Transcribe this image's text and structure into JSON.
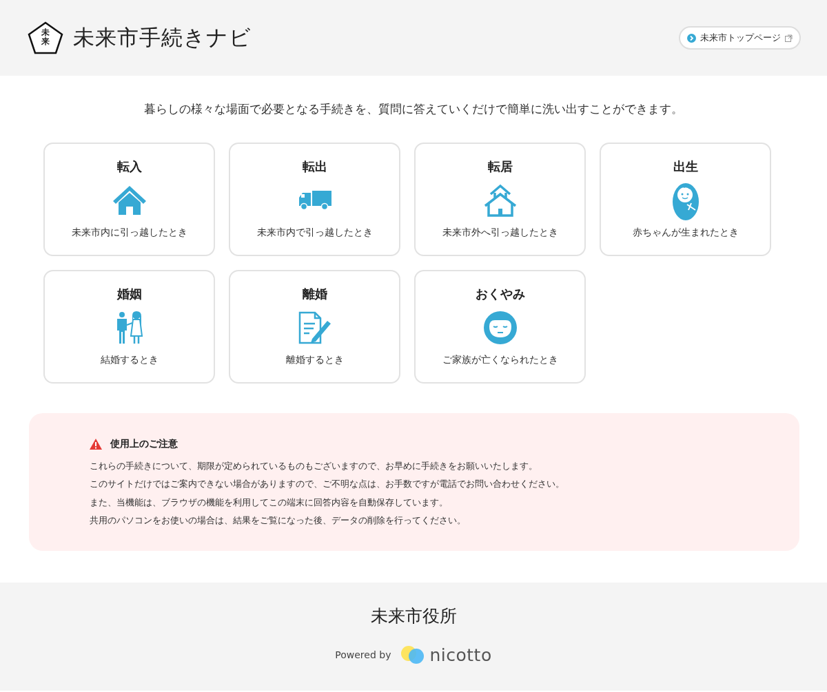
{
  "header": {
    "logo_mark": "未来",
    "title": "未来市手続きナビ",
    "top_link": "未来市トップページ"
  },
  "intro": "暮らしの様々な場面で必要となる手続きを、質問に答えていくだけで簡単に洗い出すことができます。",
  "cards": [
    {
      "title": "転入",
      "kind": "house",
      "caption": "未来市内に引っ越したとき"
    },
    {
      "title": "転出",
      "kind": "truck",
      "caption": "未来市内で引っ越したとき"
    },
    {
      "title": "転居",
      "kind": "two-houses",
      "caption": "未来市外へ引っ越したとき"
    },
    {
      "title": "出生",
      "kind": "baby",
      "caption": "赤ちゃんが生まれたとき"
    },
    {
      "title": "婚姻",
      "kind": "couple",
      "caption": "結婚するとき"
    },
    {
      "title": "離婚",
      "kind": "document",
      "caption": "離婚するとき"
    },
    {
      "title": "おくやみ",
      "kind": "face",
      "caption": "ご家族が亡くなられたとき"
    }
  ],
  "notice": {
    "title": "使用上のご注意",
    "lines": [
      "これらの手続きについて、期限が定められているものもございますので、お早めに手続きをお願いいたします。",
      "このサイトだけではご案内できない場合がありますので、ご不明な点は、お手数ですが電話でお問い合わせください。",
      "また、当機能は、ブラウザの機能を利用してこの端末に回答内容を自動保存しています。",
      "共用のパソコンをお使いの場合は、結果をご覧になった後、データの削除を行ってください。"
    ]
  },
  "footer": {
    "office": "未来市役所",
    "powered_by": "Powered by",
    "brand": "nicotto"
  }
}
